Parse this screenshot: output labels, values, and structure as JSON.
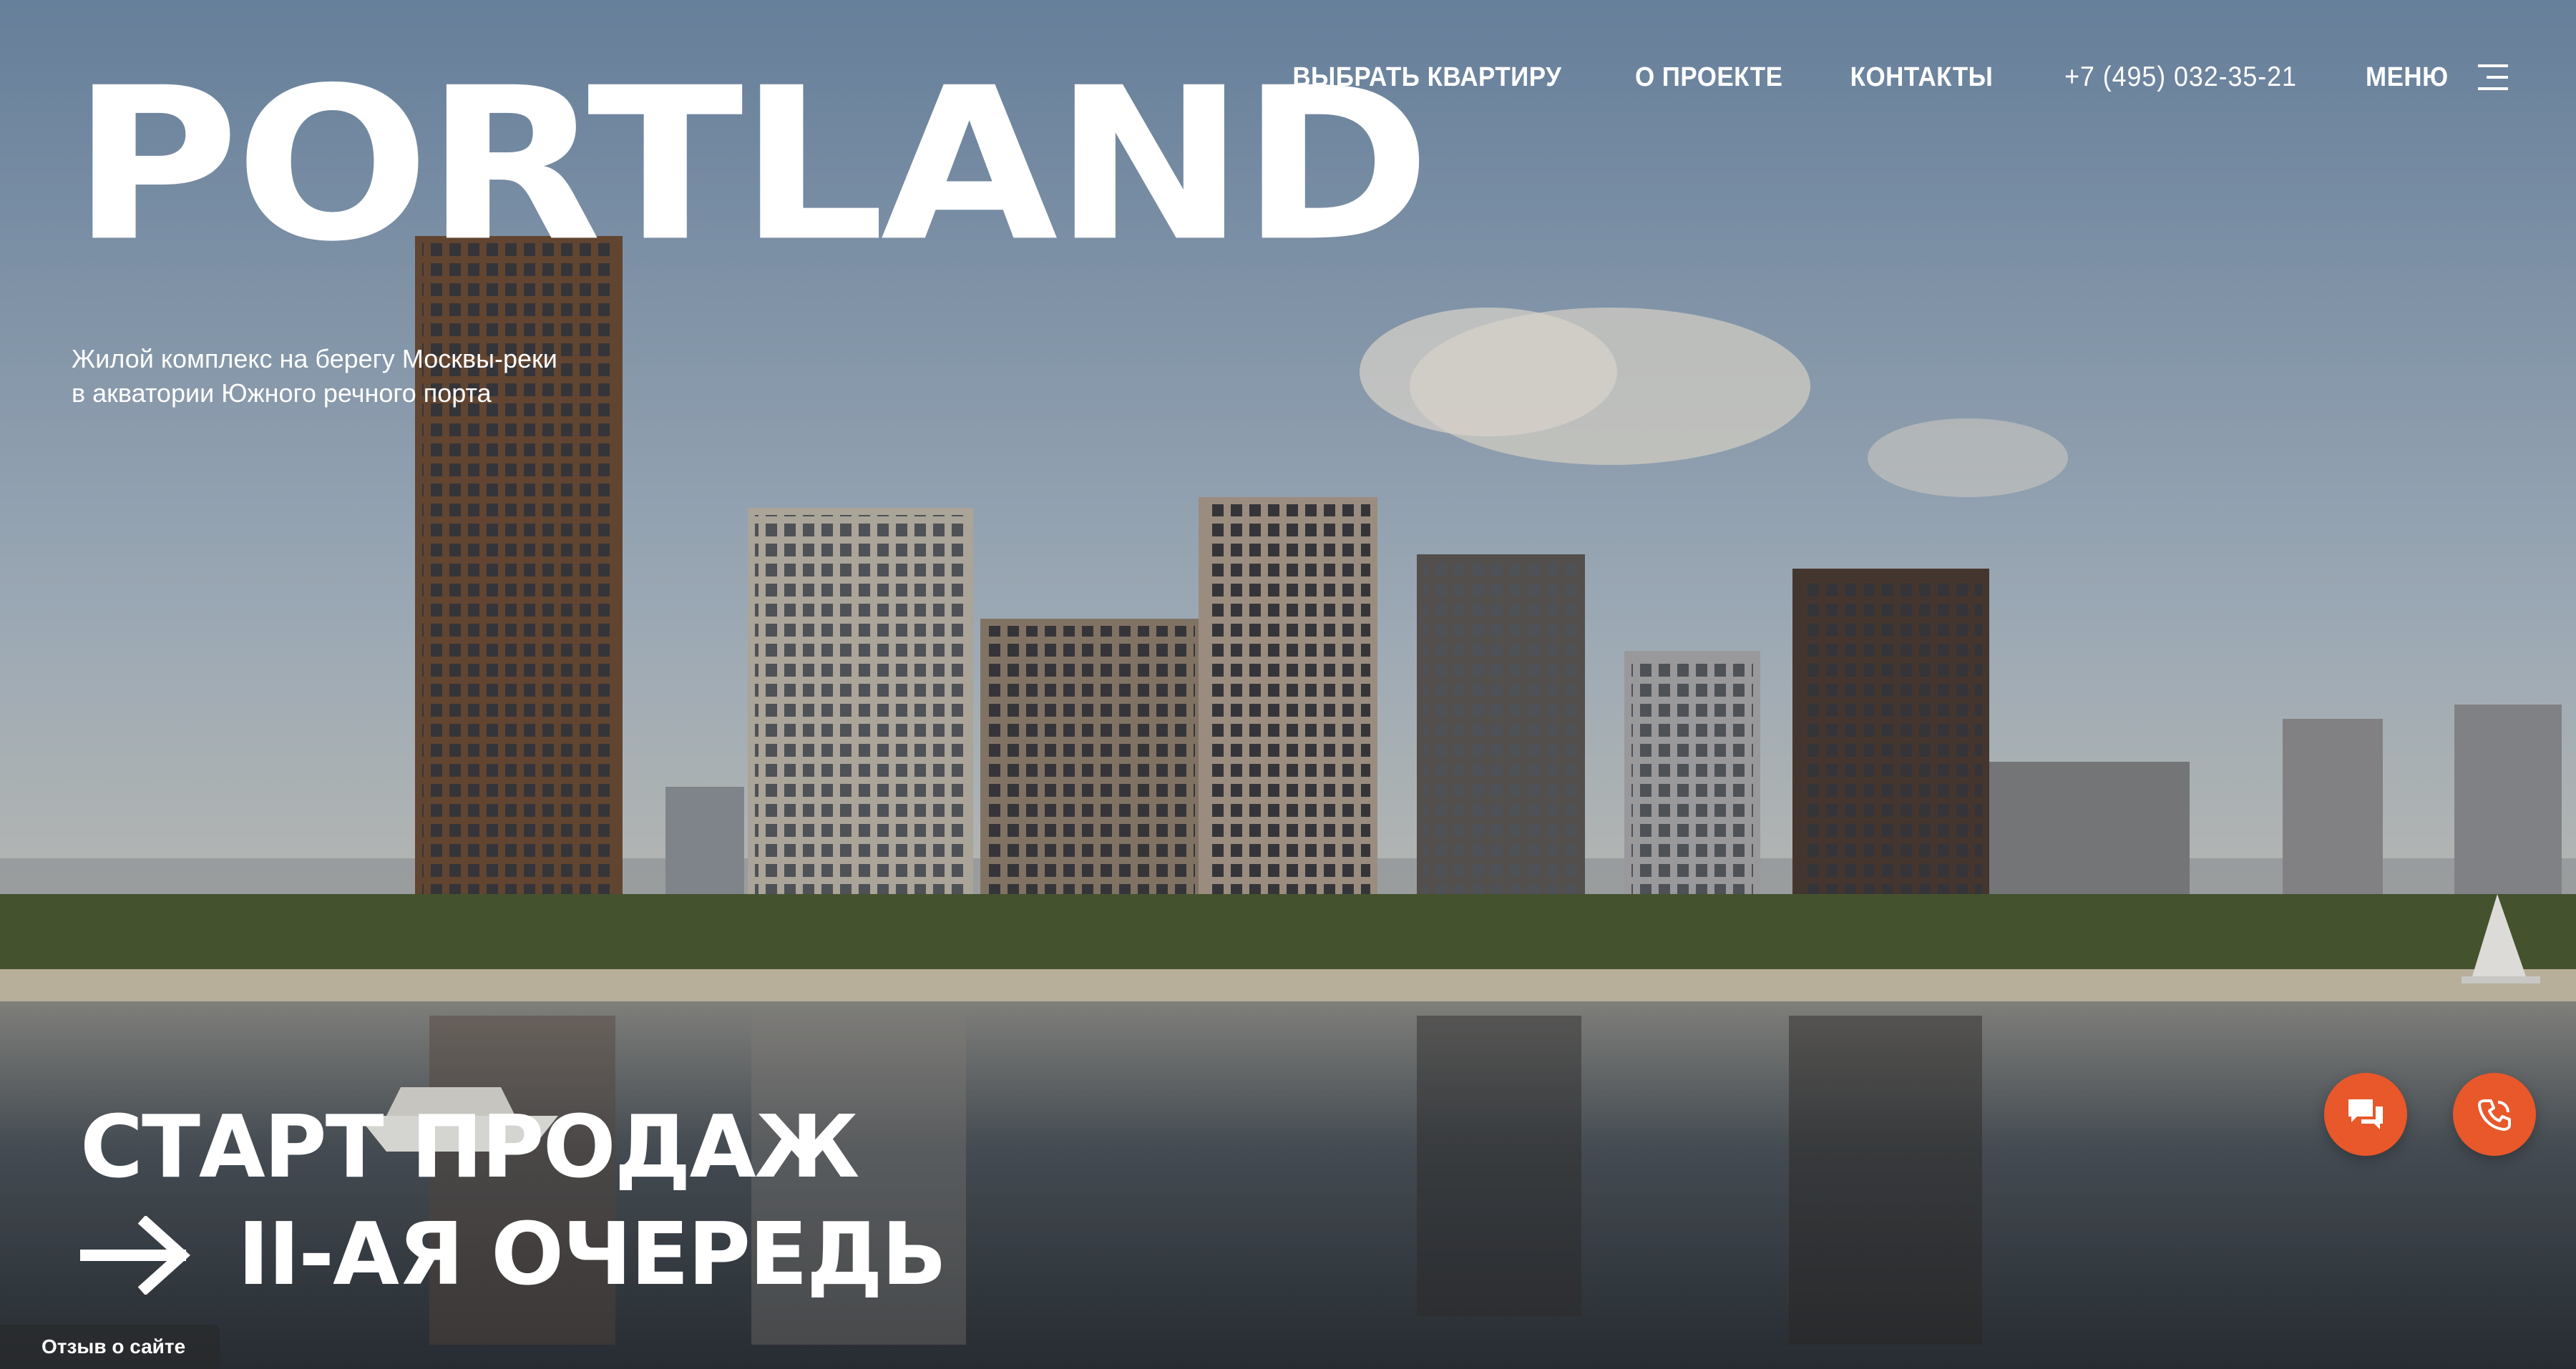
{
  "brand": {
    "logo": "PORTLAND"
  },
  "nav": {
    "choose_apartment": "ВЫБРАТЬ КВАРТИРУ",
    "about": "О ПРОЕКТЕ",
    "contacts": "КОНТАКТЫ",
    "phone": "+7 (495) 032-35-21",
    "menu": "МЕНЮ"
  },
  "hero": {
    "tagline": "Жилой комплекс на берегу Москвы-реки в акватории Южного речного порта",
    "cta_line1": "СТАРТ ПРОДАЖ",
    "cta_line2": "II-АЯ ОЧЕРЕДЬ"
  },
  "actions": {
    "chat_icon": "chat-bubbles-icon",
    "call_icon": "phone-icon",
    "accent_color": "#e8582a"
  },
  "footer": {
    "feedback": "Отзыв о сайте"
  },
  "icons": {
    "menu": "hamburger-icon",
    "arrow": "arrow-right-icon"
  }
}
